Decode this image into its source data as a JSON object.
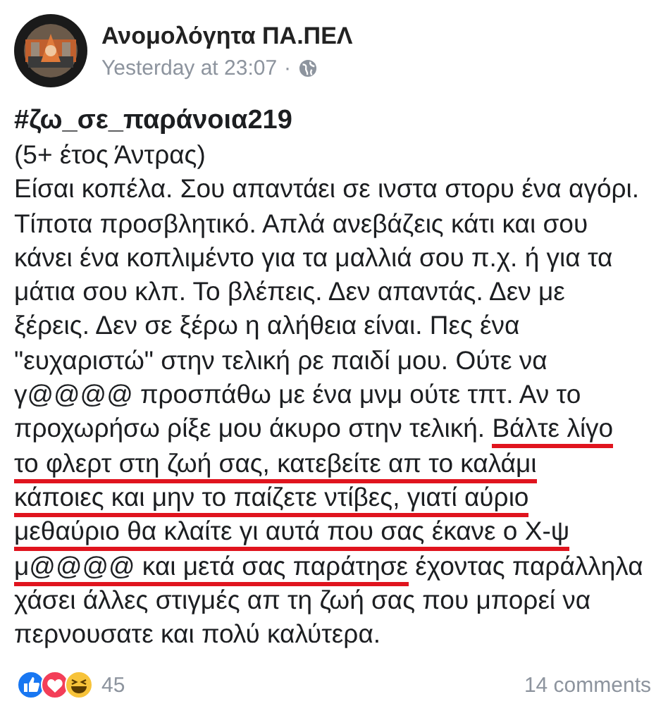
{
  "post": {
    "author": "Ανομολόγητα ΠΑ.ΠΕΛ",
    "time": "Yesterday at 23:07",
    "separator": "·",
    "hashtag": "#ζω_σε_παράνοια219",
    "lines": [
      [
        {
          "text": "(5+ έτος Άντρας)",
          "marked": false
        }
      ],
      [
        {
          "text": "Είσαι κοπέλα. Σου απαντάει σε ινστα στορυ ένα αγόρι.",
          "marked": false
        }
      ],
      [
        {
          "text": "Τίποτα προσβλητικό. Απλά ανεβάζεις κάτι και σου",
          "marked": false
        }
      ],
      [
        {
          "text": "κάνει ένα κοπλιμέντο για τα μαλλιά σου π.χ. ή για τα",
          "marked": false
        }
      ],
      [
        {
          "text": "μάτια σου κλπ. Το βλέπεις. Δεν απαντάς. Δεν με",
          "marked": false
        }
      ],
      [
        {
          "text": "ξέρεις. Δεν σε ξέρω η αλήθεια είναι. Πες ένα",
          "marked": false
        }
      ],
      [
        {
          "text": "\"ευχαριστώ\" στην τελική ρε παιδί μου. Ούτε να",
          "marked": false
        }
      ],
      [
        {
          "text": "γ@@@@ προσπάθω με ένα μνμ ούτε τπτ. Αν το",
          "marked": false
        }
      ],
      [
        {
          "text": "προχωρήσω ρίξε μου άκυρο στην τελική. ",
          "marked": false
        },
        {
          "text": "Βάλτε λίγο",
          "marked": true
        }
      ],
      [
        {
          "text": "το φλερτ στη ζωή σας, κατεβείτε απ το καλάμι",
          "marked": true
        }
      ],
      [
        {
          "text": "κάποιες και μην το παίζετε ντίβες, γιατί αύριο",
          "marked": true
        }
      ],
      [
        {
          "text": "μεθαύριο θα κλαίτε γι αυτά που σας έκανε ο Χ-ψ",
          "marked": true
        }
      ],
      [
        {
          "text": "μ@@@@ και μετά σας παράτησε",
          "marked": true
        },
        {
          "text": " έχοντας παράλληλα",
          "marked": false
        }
      ],
      [
        {
          "text": "χάσει άλλες στιγμές απ τη ζωή σας που μπορεί να",
          "marked": false
        }
      ],
      [
        {
          "text": "περνουσατε και πολύ καλύτερα.",
          "marked": false
        }
      ]
    ]
  },
  "footer": {
    "reactions": [
      {
        "kind": "like"
      },
      {
        "kind": "love"
      },
      {
        "kind": "haha"
      }
    ],
    "reaction_count": "45",
    "comments": "14 comments"
  }
}
